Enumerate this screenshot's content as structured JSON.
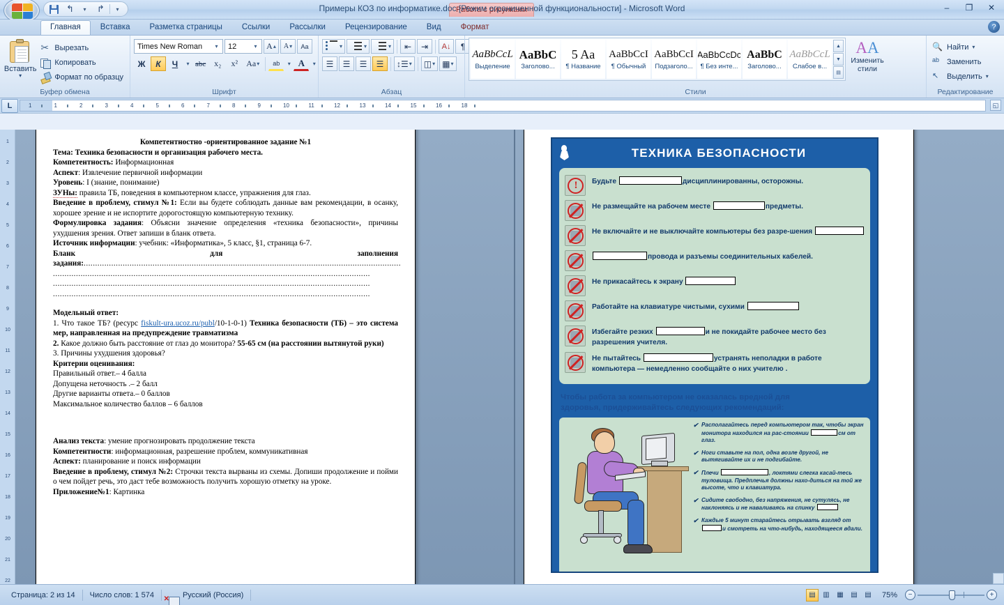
{
  "titlebar": {
    "contextual_tab": "Работа с рисунками",
    "document_title": "Примеры КОЗ по информатике.doc [Режим ограниченной функциональности] - Microsoft Word",
    "minimize": "–",
    "restore": "❐",
    "close": "✕",
    "qat": {
      "save": "save-icon",
      "undo": "↰",
      "undo_caret": "▾",
      "redo": "↱",
      "customize": "▾"
    }
  },
  "tabs": [
    {
      "label": "Главная",
      "active": true
    },
    {
      "label": "Вставка",
      "active": false
    },
    {
      "label": "Разметка страницы",
      "active": false
    },
    {
      "label": "Ссылки",
      "active": false
    },
    {
      "label": "Рассылки",
      "active": false
    },
    {
      "label": "Рецензирование",
      "active": false
    },
    {
      "label": "Вид",
      "active": false
    },
    {
      "label": "Формат",
      "active": false
    }
  ],
  "help_glyph": "?",
  "ribbon": {
    "clipboard": {
      "group_label": "Буфер обмена",
      "paste_label": "Вставить",
      "paste_caret": "▾",
      "items": [
        {
          "label": "Вырезать",
          "icon": "scissors-icon"
        },
        {
          "label": "Копировать",
          "icon": "copy-icon"
        },
        {
          "label": "Формат по образцу",
          "icon": "format-painter-icon"
        }
      ]
    },
    "font": {
      "group_label": "Шрифт",
      "font_name": "Times New Roman",
      "font_size": "12",
      "grow_font": "A",
      "shrink_font": "A",
      "clear_formatting": "Aa",
      "bold": "Ж",
      "italic": "К",
      "underline": "Ч",
      "strikethrough": "abc",
      "subscript": "x₂",
      "superscript": "x²",
      "change_case": "Aa",
      "highlight": "ab",
      "font_color": "A",
      "caret": "▾"
    },
    "paragraph": {
      "group_label": "Абзац",
      "bullets": "bullets-icon",
      "numbering": "numbering-icon",
      "multilevel": "multilevel-list-icon",
      "decrease_indent": "decrease-indent-icon",
      "increase_indent": "increase-indent-icon",
      "sort": "sort-icon",
      "show_marks": "¶",
      "align_left": "align-left-icon",
      "align_center": "align-center-icon",
      "align_right": "align-right-icon",
      "align_justify": "align-justify-icon",
      "line_spacing": "line-spacing-icon",
      "shading": "shading-icon",
      "borders": "borders-icon",
      "caret": "▾"
    },
    "styles": {
      "group_label": "Стили",
      "gallery": [
        {
          "preview": "AaBbCcL",
          "name": "Выделение",
          "style": "italic-serif"
        },
        {
          "preview": "AaBbC",
          "name": "Заголово...",
          "style": "bold-serif"
        },
        {
          "preview": "5  Aa",
          "name": "¶ Название",
          "style": "title-serif"
        },
        {
          "preview": "AaBbCcI",
          "name": "¶ Обычный",
          "style": "serif"
        },
        {
          "preview": "AaBbCcI",
          "name": "Подзаголо...",
          "style": "serif"
        },
        {
          "preview": "AaBbCcDc",
          "name": "¶ Без инте...",
          "style": "sans"
        },
        {
          "preview": "AaBbC",
          "name": "Заголово...",
          "style": "bold-serif"
        },
        {
          "preview": "AaBbCcL",
          "name": "Слабое в...",
          "style": "italic-grey"
        }
      ],
      "scroll_up": "▲",
      "scroll_down": "▼",
      "scroll_more": "▤",
      "change_styles_line1": "Изменить",
      "change_styles_line2": "стили",
      "change_styles_caret": "▾"
    },
    "editing": {
      "group_label": "Редактирование",
      "items": [
        {
          "label": "Найти",
          "icon": "binoculars-icon",
          "caret": "▾"
        },
        {
          "label": "Заменить",
          "icon": "replace-icon",
          "caret": ""
        },
        {
          "label": "Выделить",
          "icon": "select-cursor-icon",
          "caret": "▾"
        }
      ]
    }
  },
  "ruler": {
    "tab_stop_button": "L",
    "ticks": [
      "1",
      "1",
      "2",
      "3",
      "4",
      "5",
      "6",
      "7",
      "8",
      "9",
      "10",
      "11",
      "12",
      "13",
      "14",
      "15",
      "16",
      "18"
    ],
    "vertical_ticks": [
      "1",
      "2",
      "3",
      "4",
      "5",
      "6",
      "7",
      "8",
      "9",
      "10",
      "11",
      "12",
      "13",
      "14",
      "15",
      "16",
      "17",
      "18",
      "19",
      "20",
      "21",
      "22"
    ]
  },
  "document": {
    "title": "Компетентностно -ориентированное задание №1",
    "lines": [
      {
        "bold": "Тема:",
        "rest": " Техника безопасности и организация рабочего места.",
        "all_bold": true
      },
      {
        "bold": "Компетентность:",
        "rest": " Информационная"
      },
      {
        "bold": "Аспект",
        "rest": ": Извлечение первичной информации"
      },
      {
        "bold": "Уровень",
        "rest": ": I (знание, понимание)"
      },
      {
        "bold": "ЗУНы:",
        "rest": " правила ТБ, поведения в компьютерном классе, упражнения для глаз."
      },
      {
        "bold": "Введение в проблему, стимул №1:",
        "rest": "  Если вы будете соблюдать данные  вам рекомендации, в осанку, хорошее зрение и не испортите дорогостоящую компьютерную технику."
      },
      {
        "bold": "Формулировка задания",
        "rest": ": Объясни значение определения «техника безопасности», причины ухудшения зрения. Ответ запиши в бланк ответа."
      },
      {
        "bold": "Источник информации",
        "rest": ": учебник: «Информатика», 5 класс, §1, страница 6-7."
      }
    ],
    "blank_label": "Бланк для заполнения задания:",
    "dots": "..........................................................................................................................................",
    "model_answer_heading": "Модельный ответ:",
    "answers": [
      {
        "num": "1.",
        "q": " Что такое ТБ? (ресурс ",
        "link": "fiskult-ura.ucoz.ru/publ",
        "link_tail": "/10-1-0-1) ",
        "bold_ans": "Техника безопасности (ТБ) – это система мер, направленная на предупреждение травматизма"
      },
      {
        "num": "2.",
        "q": " Какое должно быть расстояние от глаз до монитора? ",
        "bold_ans": "55-65 см (на расстоянии вытянутой руки)"
      },
      {
        "num": "3.",
        "q": " Причины ухудшения здоровья?",
        "bold_ans": ""
      }
    ],
    "criteria_heading": "Критерии оценивания:",
    "criteria": [
      "Правильный ответ.– 4 балла",
      " Допущена неточность .– 2 балл",
      " Другие варианты ответа.– 0 баллов",
      "Максимальное количество баллов – 6 баллов"
    ],
    "section2": [
      {
        "bold": "Анализ текста",
        "rest": ": умение прогнозировать продолжение текста"
      },
      {
        "bold": "Компетентности",
        "rest": ": информационная, разрешение проблем, коммуникативная"
      },
      {
        "bold": "Аспект:",
        "rest": " планирование и поиск информации"
      },
      {
        "bold": "Введение в проблему, стимул №2:",
        "rest": "  Строчки текста вырваны из схемы. Допиши продолжение и пойми о чем пойдет речь, это даст тебе возможность получить хорошую отметку на уроке."
      },
      {
        "bold": "Приложение№1",
        "rest": ": Картинка"
      }
    ]
  },
  "poster": {
    "title": "ТЕХНИКА БЕЗОПАСНОСТИ",
    "rules": [
      {
        "icon": "warning-exclamation-sign",
        "before": "Будьте ",
        "blank": 90,
        "after": "дисциплинированны, осторожны."
      },
      {
        "icon": "no-food-sign",
        "before": "Не размещайте на рабочем месте ",
        "blank": 74,
        "after": "предметы."
      },
      {
        "icon": "no-power-switch-sign",
        "before": "Не включайте и не выключайте компьютеры без разре-шения ",
        "blank": 70,
        "after": ""
      },
      {
        "icon": "no-cables-sign",
        "before": "",
        "blank": 78,
        "after": "провода и разъемы соединительных кабелей."
      },
      {
        "icon": "no-touch-screen-sign",
        "before": "Не прикасайтесь к экрану ",
        "blank": 72,
        "after": ""
      },
      {
        "icon": "no-dirty-hands-sign",
        "before": "Работайте на клавиатуре чистыми, сухими ",
        "blank": 74,
        "after": ""
      },
      {
        "icon": "no-running-sign",
        "before": "Избегайте резких ",
        "blank": 70,
        "after": "и не покидайте рабочее место без разрешения учителя."
      },
      {
        "icon": "no-self-repair-sign",
        "before": "Не пытайтесь ",
        "blank": 100,
        "after": "устранять неполадки в работе компьютера — немедленно сообщайте о них учителю ."
      }
    ],
    "subtitle_line1": "Чтобы работа за компьютером не оказалась вредной для",
    "subtitle_line2": "здоровья, придерживайтесь следующих рекомендаций:",
    "tips": [
      {
        "check": "✔",
        "before": "Располагайтесь перед компьютером так, чтобы экран монитора находился на рас-стоянии ",
        "blank": 38,
        "after": "см от глаз."
      },
      {
        "check": "✔",
        "before": "Ноги ставьте на пол, одна возле другой, не вытягивайте их и не подгибайте.",
        "blank": 0,
        "after": ""
      },
      {
        "check": "✔",
        "before": "Плечи ",
        "blank": 68,
        "after": ", локтями слегка касай-тесь туловища. Предплечья должны нахо-диться на той же высоте, что и клавиатура."
      },
      {
        "check": "✔",
        "before": "Сидите свободно, без напряжения, не сутулясь, не наклоняясь и не наваливаясь на спинку ",
        "blank": 30,
        "after": ""
      },
      {
        "check": "✔",
        "before": "Каждые 5 минут старайтесь отрывать взгляд от ",
        "blank": 28,
        "after": "и смотреть на что-нибудь, находящееся вдали."
      }
    ]
  },
  "statusbar": {
    "page": "Страница: 2 из 14",
    "words": "Число слов: 1 574",
    "proofing_icon": "proofing-errors-icon",
    "language": "Русский (Россия)",
    "views": [
      {
        "name": "print-layout-view",
        "glyph": "▤",
        "active": true
      },
      {
        "name": "full-screen-reading-view",
        "glyph": "▥",
        "active": false
      },
      {
        "name": "web-layout-view",
        "glyph": "▦",
        "active": false
      },
      {
        "name": "outline-view",
        "glyph": "▤",
        "active": false
      },
      {
        "name": "draft-view",
        "glyph": "▤",
        "active": false
      }
    ],
    "zoom": "75%",
    "zoom_out": "−",
    "zoom_in": "+"
  },
  "colors": {
    "poster_blue": "#1d5fa8",
    "poster_green": "#c9e0cf",
    "accent_orange": "#ffca57",
    "link_blue": "#1b5fae",
    "sign_red": "#cf2222"
  }
}
